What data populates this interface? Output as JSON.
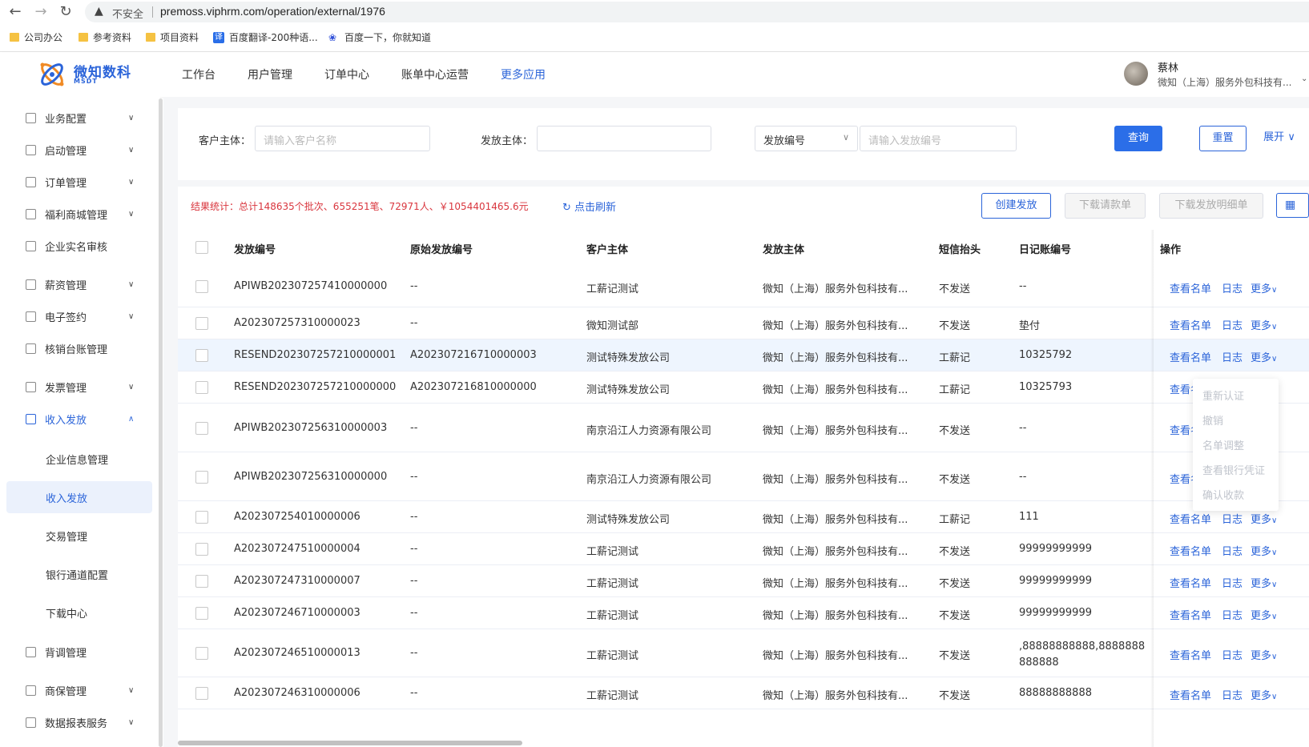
{
  "browser": {
    "insecure_label": "不安全",
    "url": "premoss.viphrm.com/operation/external/1976",
    "bookmarks": [
      {
        "label": "公司办公",
        "icon": "folder-icon"
      },
      {
        "label": "参考资料",
        "icon": "folder-icon"
      },
      {
        "label": "项目资料",
        "icon": "folder-icon"
      },
      {
        "label": "百度翻译-200种语...",
        "icon": "translate-icon",
        "icon_text": "译"
      },
      {
        "label": "百度一下，你就知道",
        "icon": "baidu-paw-icon"
      }
    ]
  },
  "header": {
    "logo_text": "微知数科",
    "logo_sub": "MSDT",
    "nav": [
      "工作台",
      "用户管理",
      "订单中心",
      "账单中心运营",
      "更多应用"
    ],
    "active_nav": "更多应用",
    "user_name": "蔡林",
    "user_org": "微知（上海）服务外包科技有..."
  },
  "sidebar": {
    "items": [
      {
        "label": "业务配置",
        "has_children": true
      },
      {
        "label": "启动管理",
        "has_children": true
      },
      {
        "label": "订单管理",
        "has_children": true
      },
      {
        "label": "福利商城管理",
        "has_children": true
      },
      {
        "label": "企业实名审核",
        "has_children": false
      },
      {
        "label": "薪资管理",
        "has_children": true
      },
      {
        "label": "电子签约",
        "has_children": true
      },
      {
        "label": "核销台账管理",
        "has_children": false
      },
      {
        "label": "发票管理",
        "has_children": true
      },
      {
        "label": "收入发放",
        "has_children": true,
        "open": true
      }
    ],
    "sub_items": [
      "企业信息管理",
      "收入发放",
      "交易管理",
      "银行通道配置",
      "下载中心"
    ],
    "active_sub": "收入发放",
    "items_after": [
      {
        "label": "背调管理",
        "has_children": false
      },
      {
        "label": "商保管理",
        "has_children": true
      },
      {
        "label": "数据报表服务",
        "has_children": true
      }
    ]
  },
  "filters": {
    "customer_label": "客户主体：",
    "customer_placeholder": "请输入客户名称",
    "issuer_label": "发放主体：",
    "issuer_value": "",
    "type_select": "发放编号",
    "code_placeholder": "请输入发放编号",
    "query_btn": "查询",
    "reset_btn": "重置",
    "expand_btn": "展开"
  },
  "toolbar": {
    "stats": "结果统计：总计148635个批次、655251笔、72971人、￥1054401465.6元",
    "refresh": "点击刷新",
    "create_btn": "创建发放",
    "download_request_btn": "下载请款单",
    "download_detail_btn": "下载发放明细单"
  },
  "table": {
    "columns": [
      "发放编号",
      "原始发放编号",
      "客户主体",
      "发放主体",
      "短信抬头",
      "日记账编号",
      "操作"
    ],
    "op_links": {
      "view": "查看名单",
      "log": "日志",
      "more": "更多"
    },
    "rows": [
      {
        "code": "APIWB202307257410000000",
        "orig": "--",
        "customer": "工薪记测试",
        "issuer": "微知（上海）服务外包科技有...",
        "sms": "不发送",
        "journal": "--"
      },
      {
        "code": "A202307257310000023",
        "orig": "--",
        "customer": "微知测试部",
        "issuer": "微知（上海）服务外包科技有...",
        "sms": "不发送",
        "journal": "垫付"
      },
      {
        "code": "RESEND202307257210000001",
        "orig": "A202307216710000003",
        "customer": "测试特殊发放公司",
        "issuer": "微知（上海）服务外包科技有...",
        "sms": "工薪记",
        "journal": "10325792"
      },
      {
        "code": "RESEND202307257210000000",
        "orig": "A202307216810000000",
        "customer": "测试特殊发放公司",
        "issuer": "微知（上海）服务外包科技有...",
        "sms": "工薪记",
        "journal": "10325793"
      },
      {
        "code": "APIWB202307256310000003",
        "orig": "--",
        "customer": "南京沿江人力资源有限公司",
        "issuer": "微知（上海）服务外包科技有...",
        "sms": "不发送",
        "journal": "--"
      },
      {
        "code": "APIWB202307256310000000",
        "orig": "--",
        "customer": "南京沿江人力资源有限公司",
        "issuer": "微知（上海）服务外包科技有...",
        "sms": "不发送",
        "journal": "--"
      },
      {
        "code": "A202307254010000006",
        "orig": "--",
        "customer": "测试特殊发放公司",
        "issuer": "微知（上海）服务外包科技有...",
        "sms": "工薪记",
        "journal": "111"
      },
      {
        "code": "A202307247510000004",
        "orig": "--",
        "customer": "工薪记测试",
        "issuer": "微知（上海）服务外包科技有...",
        "sms": "不发送",
        "journal": "99999999999"
      },
      {
        "code": "A202307247310000007",
        "orig": "--",
        "customer": "工薪记测试",
        "issuer": "微知（上海）服务外包科技有...",
        "sms": "不发送",
        "journal": "99999999999"
      },
      {
        "code": "A202307246710000003",
        "orig": "--",
        "customer": "工薪记测试",
        "issuer": "微知（上海）服务外包科技有...",
        "sms": "不发送",
        "journal": "99999999999"
      },
      {
        "code": "A202307246510000013",
        "orig": "--",
        "customer": "工薪记测试",
        "issuer": "微知（上海）服务外包科技有...",
        "sms": "不发送",
        "journal": ",88888888888,8888888888888"
      },
      {
        "code": "A202307246310000006",
        "orig": "--",
        "customer": "工薪记测试",
        "issuer": "微知（上海）服务外包科技有...",
        "sms": "不发送",
        "journal": "88888888888"
      }
    ]
  },
  "more_dropdown": [
    "重新认证",
    "撤销",
    "名单调整",
    "查看银行凭证",
    "确认收款"
  ],
  "colors": {
    "primary": "#2b6ee8",
    "link": "#2b64d9",
    "stats_red": "#d9363e",
    "hover_row": "#eef5fe"
  }
}
